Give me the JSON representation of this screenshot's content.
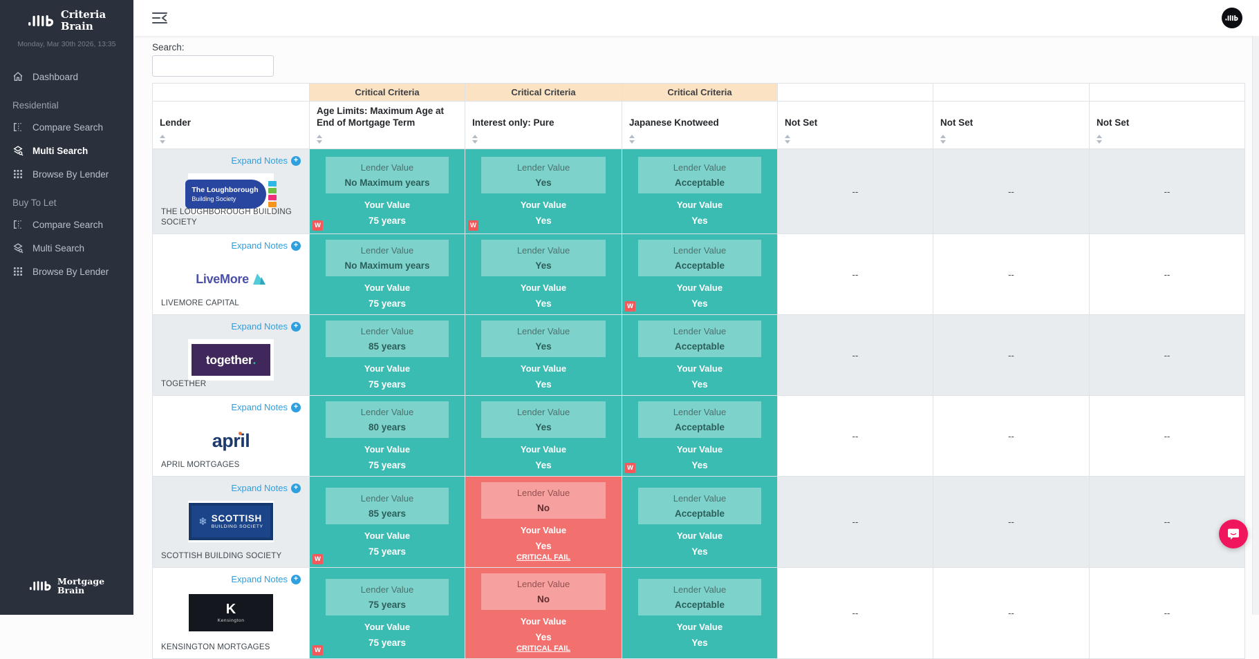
{
  "sidebar": {
    "brand": {
      "line1": "Criteria",
      "line2": "Brain"
    },
    "datetime": "Monday, Mar 30th 2026, 13:35",
    "dashboard_label": "Dashboard",
    "sections": [
      {
        "label": "Residential",
        "items": [
          "Compare Search",
          "Multi Search",
          "Browse By Lender"
        ]
      },
      {
        "label": "Buy To Let",
        "items": [
          "Compare Search",
          "Multi Search",
          "Browse By Lender"
        ]
      }
    ],
    "active_item": "Multi Search",
    "footer_brand": {
      "line1": "Mortgage",
      "line2": "Brain"
    }
  },
  "search": {
    "label": "Search:",
    "value": ""
  },
  "table": {
    "group_headers": [
      "",
      "Critical Criteria",
      "Critical Criteria",
      "Critical Criteria",
      "",
      "",
      ""
    ],
    "columns": [
      "Lender",
      "Age Limits: Maximum Age at End of Mortgage Term",
      "Interest only: Pure",
      "Japanese Knotweed",
      "Not Set",
      "Not Set",
      "Not Set"
    ],
    "expand_notes_label": "Expand Notes",
    "lender_value_label": "Lender Value",
    "your_value_label": "Your Value",
    "critical_fail_label": "CRITICAL FAIL",
    "warning_badge": "W",
    "empty_value": "--",
    "rows": [
      {
        "lender": "THE LOUGHBOROUGH BUILDING SOCIETY",
        "logo": {
          "type": "loughborough",
          "line1": "The Loughborough",
          "line2": "Building Society"
        },
        "cells": [
          {
            "lender_value": "No Maximum years",
            "your_value": "75 years",
            "status": "pass",
            "warning": true,
            "critical_fail": false
          },
          {
            "lender_value": "Yes",
            "your_value": "Yes",
            "status": "pass",
            "warning": true,
            "critical_fail": false
          },
          {
            "lender_value": "Acceptable",
            "your_value": "Yes",
            "status": "pass",
            "warning": false,
            "critical_fail": false
          }
        ]
      },
      {
        "lender": "LIVEMORE CAPITAL",
        "logo": {
          "type": "livemore",
          "text": "LiveMore"
        },
        "cells": [
          {
            "lender_value": "No Maximum years",
            "your_value": "75 years",
            "status": "pass",
            "warning": false,
            "critical_fail": false
          },
          {
            "lender_value": "Yes",
            "your_value": "Yes",
            "status": "pass",
            "warning": false,
            "critical_fail": false
          },
          {
            "lender_value": "Acceptable",
            "your_value": "Yes",
            "status": "pass",
            "warning": true,
            "critical_fail": false
          }
        ]
      },
      {
        "lender": "TOGETHER",
        "logo": {
          "type": "together",
          "text": "together."
        },
        "cells": [
          {
            "lender_value": "85 years",
            "your_value": "75 years",
            "status": "pass",
            "warning": false,
            "critical_fail": false
          },
          {
            "lender_value": "Yes",
            "your_value": "Yes",
            "status": "pass",
            "warning": false,
            "critical_fail": false
          },
          {
            "lender_value": "Acceptable",
            "your_value": "Yes",
            "status": "pass",
            "warning": false,
            "critical_fail": false
          }
        ]
      },
      {
        "lender": "APRIL MORTGAGES",
        "logo": {
          "type": "april",
          "text": "april"
        },
        "cells": [
          {
            "lender_value": "80 years",
            "your_value": "75 years",
            "status": "pass",
            "warning": false,
            "critical_fail": false
          },
          {
            "lender_value": "Yes",
            "your_value": "Yes",
            "status": "pass",
            "warning": false,
            "critical_fail": false
          },
          {
            "lender_value": "Acceptable",
            "your_value": "Yes",
            "status": "pass",
            "warning": true,
            "critical_fail": false
          }
        ]
      },
      {
        "lender": "SCOTTISH BUILDING SOCIETY",
        "logo": {
          "type": "scottish",
          "line1": "SCOTTISH",
          "line2": "BUILDING SOCIETY"
        },
        "cells": [
          {
            "lender_value": "85 years",
            "your_value": "75 years",
            "status": "pass",
            "warning": true,
            "critical_fail": false
          },
          {
            "lender_value": "No",
            "your_value": "Yes",
            "status": "fail",
            "warning": false,
            "critical_fail": true
          },
          {
            "lender_value": "Acceptable",
            "your_value": "Yes",
            "status": "pass",
            "warning": false,
            "critical_fail": false
          }
        ]
      },
      {
        "lender": "KENSINGTON MORTGAGES",
        "logo": {
          "type": "kensington",
          "text": "Kensington"
        },
        "cells": [
          {
            "lender_value": "75 years",
            "your_value": "75 years",
            "status": "pass",
            "warning": true,
            "critical_fail": false
          },
          {
            "lender_value": "No",
            "your_value": "Yes",
            "status": "fail",
            "warning": false,
            "critical_fail": true
          },
          {
            "lender_value": "Acceptable",
            "your_value": "Yes",
            "status": "pass",
            "warning": false,
            "critical_fail": false
          }
        ]
      }
    ]
  },
  "icons": {
    "topbar_toggle": "menu-fold",
    "avatar": "mortgage-brain-logo",
    "dashboard": "home",
    "compare_search": "compare-columns",
    "multi_search": "layered-search",
    "browse_by_lender": "grid",
    "expand_notes": "plus-circle",
    "sort": "sort-arrows",
    "chat": "chat-bubble"
  },
  "colors": {
    "sidebar_bg": "#2a313d",
    "pass_teal": "#3bbcb2",
    "fail_red": "#f2716f",
    "warning_red": "#f3595b",
    "critical_header_peach": "#fbe2c2",
    "row_stripe": "#e9ecef",
    "link_blue": "#2e9fdf",
    "chat_pink": "#f0165e"
  }
}
